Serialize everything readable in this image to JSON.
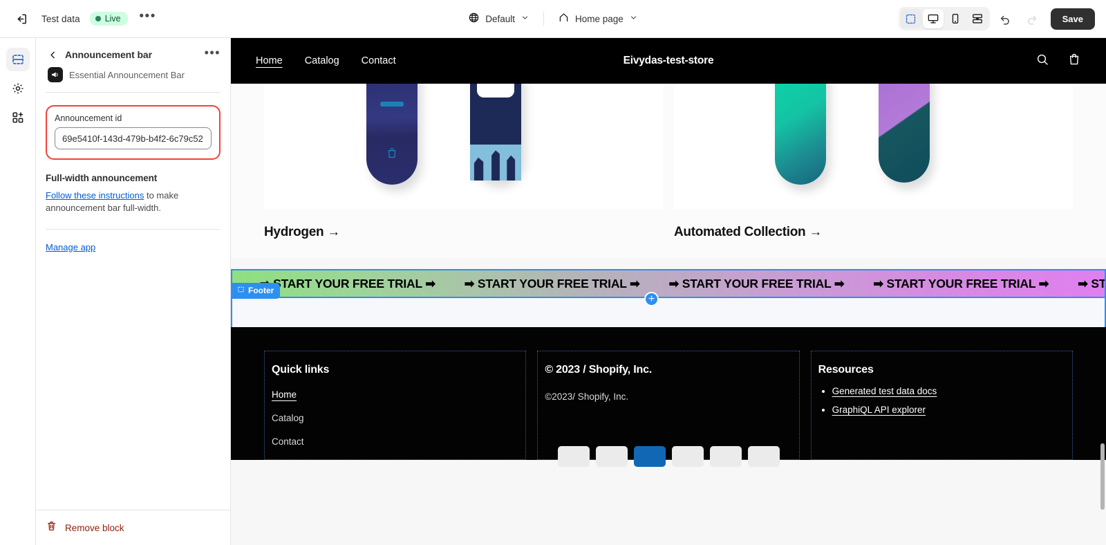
{
  "topbar": {
    "exit_icon": "exit-icon",
    "shop_name": "Test data",
    "status": "Live",
    "more_label": "•••",
    "locale": {
      "icon": "globe-icon",
      "label": "Default",
      "chevron": "⌄"
    },
    "page": {
      "icon": "home-icon",
      "label": "Home page",
      "chevron": "⌄"
    },
    "views": [
      {
        "name": "select-tool",
        "icon": "marquee-select-icon",
        "active": false,
        "selected_tool": true
      },
      {
        "name": "desktop-view",
        "icon": "desktop-icon",
        "active": true
      },
      {
        "name": "mobile-view",
        "icon": "mobile-icon",
        "active": false
      },
      {
        "name": "fullscreen-view",
        "icon": "fullscreen-icon",
        "active": false
      }
    ],
    "undo_icon": "undo-icon",
    "redo_icon": "redo-icon",
    "save_label": "Save"
  },
  "rail": {
    "items": [
      {
        "name": "sections",
        "icon": "sections-icon",
        "active": true
      },
      {
        "name": "settings",
        "icon": "gear-icon",
        "active": false
      },
      {
        "name": "apps",
        "icon": "apps-add-icon",
        "active": false
      }
    ]
  },
  "sidebar": {
    "back_icon": "chevron-left-icon",
    "title": "Announcement bar",
    "more_label": "•••",
    "app_icon": "megaphone-icon",
    "app_name": "Essential Announcement Bar",
    "field": {
      "label": "Announcement id",
      "value": "69e5410f-143d-479b-b4f2-6c79c52",
      "placeholder": "Announcement id"
    },
    "section_title": "Full-width announcement",
    "help_link": "Follow these instructions",
    "help_rest": " to make announcement bar full-width.",
    "manage_link": "Manage app",
    "remove": {
      "icon": "trash-icon",
      "label": "Remove block"
    }
  },
  "preview": {
    "store_header": {
      "nav": [
        {
          "label": "Home",
          "current": true
        },
        {
          "label": "Catalog",
          "current": false
        },
        {
          "label": "Contact",
          "current": false
        }
      ],
      "store_title": "Eivydas-test-store",
      "search_icon": "search-icon",
      "cart_icon": "cart-icon"
    },
    "collections": [
      {
        "name": "Hydrogen",
        "arrow": "→"
      },
      {
        "name": "Automated Collection",
        "arrow": "→"
      }
    ],
    "announcement": {
      "badge_label": "Footer",
      "badge_icon": "section-icon",
      "add_icon": "+",
      "marquee_text": "➡ START YOUR FREE TRIAL ➡",
      "repeats": 5,
      "gradient_start": "#8ee080",
      "gradient_end": "#e07ff0",
      "outline_color": "#2d8ff0"
    },
    "footer": {
      "columns": [
        {
          "heading": "Quick links",
          "links": [
            {
              "label": "Home",
              "current": true
            },
            {
              "label": "Catalog",
              "current": false
            },
            {
              "label": "Contact",
              "current": false
            }
          ]
        },
        {
          "heading": "© 2023 / Shopify, Inc.",
          "text": "©2023/ Shopify, Inc."
        },
        {
          "heading": "Resources",
          "list": [
            {
              "label": "Generated test data docs"
            },
            {
              "label": "GraphiQL API explorer"
            }
          ]
        }
      ]
    }
  }
}
